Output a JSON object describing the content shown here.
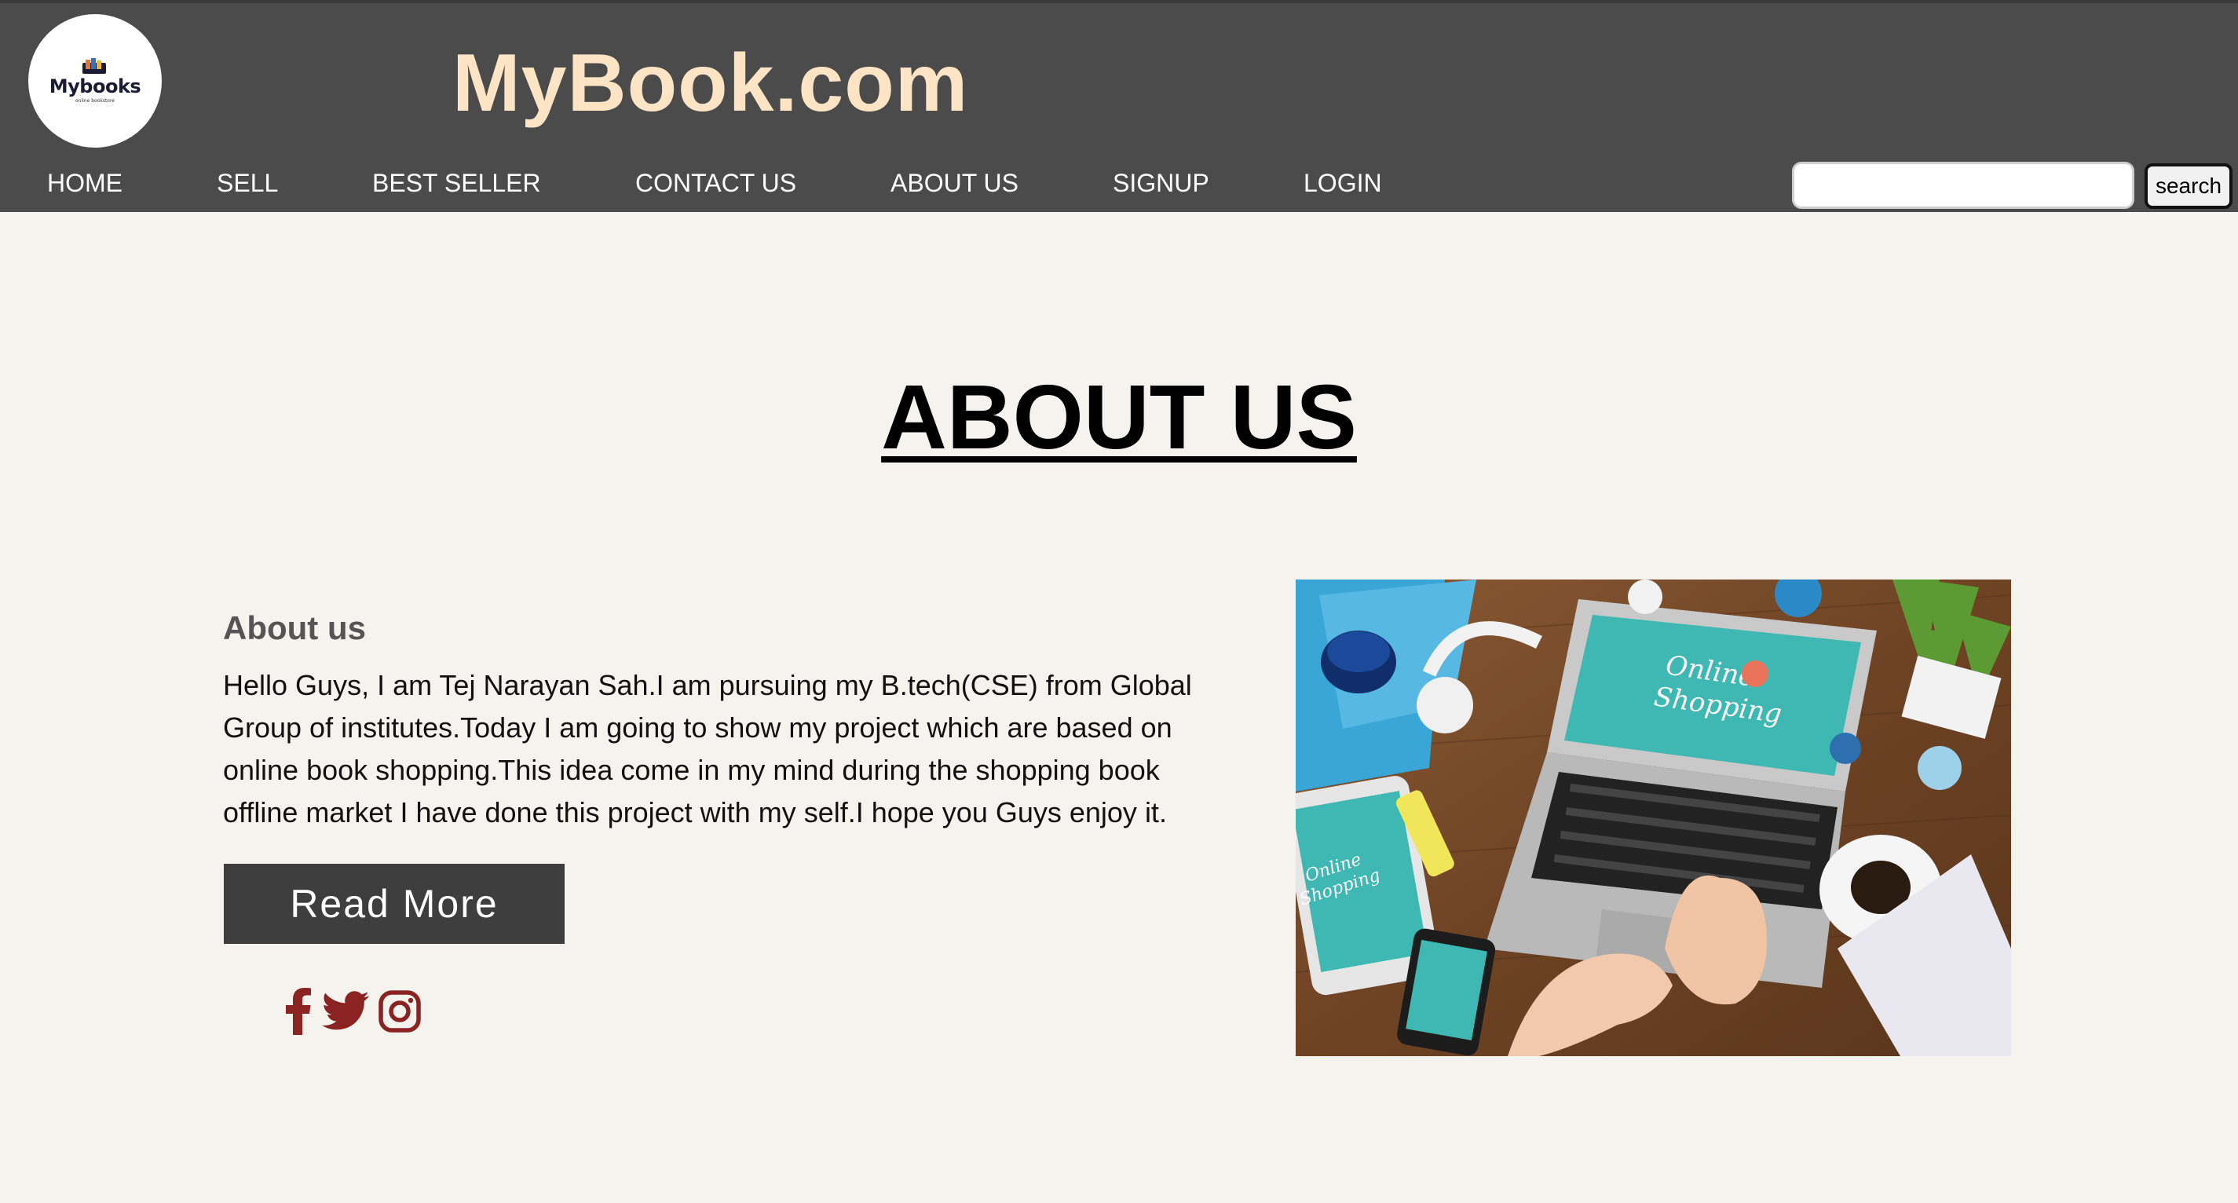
{
  "header": {
    "logo": {
      "word": "Mybooks",
      "tagline": "online bookstore"
    },
    "site_title": "MyBook.com"
  },
  "nav": {
    "items": [
      {
        "label": "HOME"
      },
      {
        "label": "SELL"
      },
      {
        "label": "BEST SELLER"
      },
      {
        "label": "CONTACT US"
      },
      {
        "label": "ABOUT US"
      },
      {
        "label": "SIGNUP"
      },
      {
        "label": "LOGIN"
      }
    ],
    "search": {
      "value": "",
      "placeholder": "",
      "button_label": "search"
    }
  },
  "main": {
    "heading": "ABOUT US",
    "subtitle": "About us",
    "body": "Hello Guys, I am Tej Narayan Sah.I am pursuing my B.tech(CSE) from Global Group of institutes.Today I am going to show my project which are based on online book shopping.This idea come in my mind during the shopping book offline market I have done this project with my self.I hope you Guys enjoy it.",
    "read_more_label": "Read More",
    "social_icons": [
      "facebook-icon",
      "twitter-icon",
      "instagram-icon"
    ],
    "image": {
      "screen_text": "Online Shopping"
    }
  },
  "colors": {
    "header_bg": "#4b4b4b",
    "title": "#fde4c4",
    "page_bg": "#f5f3ee",
    "button_bg": "#3e3e3e",
    "social": "#8b2323"
  }
}
